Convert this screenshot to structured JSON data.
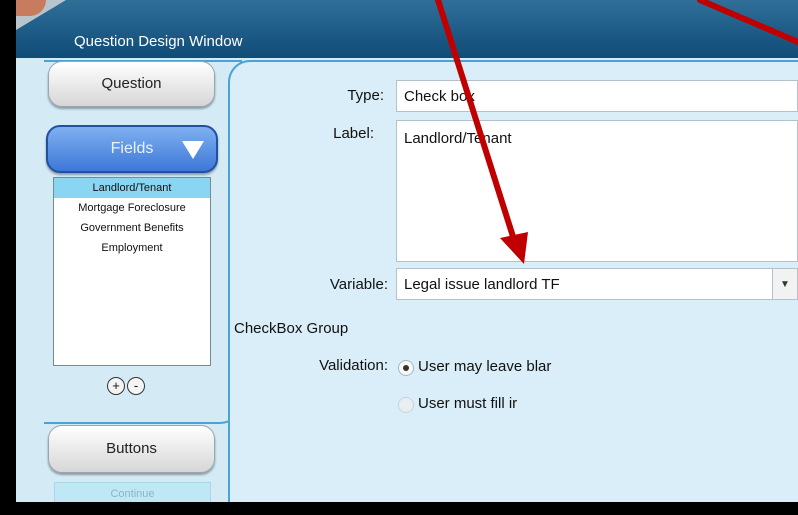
{
  "window": {
    "title": "Question Design Window"
  },
  "sidebar": {
    "question_label": "Question",
    "fields_label": "Fields",
    "fields_list": [
      "Landlord/Tenant",
      "Mortgage Foreclosure",
      "Government Benefits",
      "Employment"
    ],
    "selected_index": 0,
    "add_symbol": "+",
    "remove_symbol": "-",
    "buttons_label": "Buttons",
    "buttons_list_item": "Continue"
  },
  "form": {
    "type_label": "Type:",
    "type_value": "Check box",
    "label_label": "Label:",
    "label_value": "Landlord/Tenant",
    "variable_label": "Variable:",
    "variable_value": "Legal issue landlord TF",
    "checkbox_group_label": "CheckBox Group",
    "validation_label": "Validation:",
    "validation_options": [
      "User may leave blar",
      "User must fill ir"
    ],
    "validation_selected": 0
  },
  "colors": {
    "annotation_arrow": "#c00000",
    "titlebar": "#0f4c78",
    "panel_bg": "#d4ebf6",
    "selected_item": "#8ad6f2",
    "fields_button": "#3d78d8"
  }
}
